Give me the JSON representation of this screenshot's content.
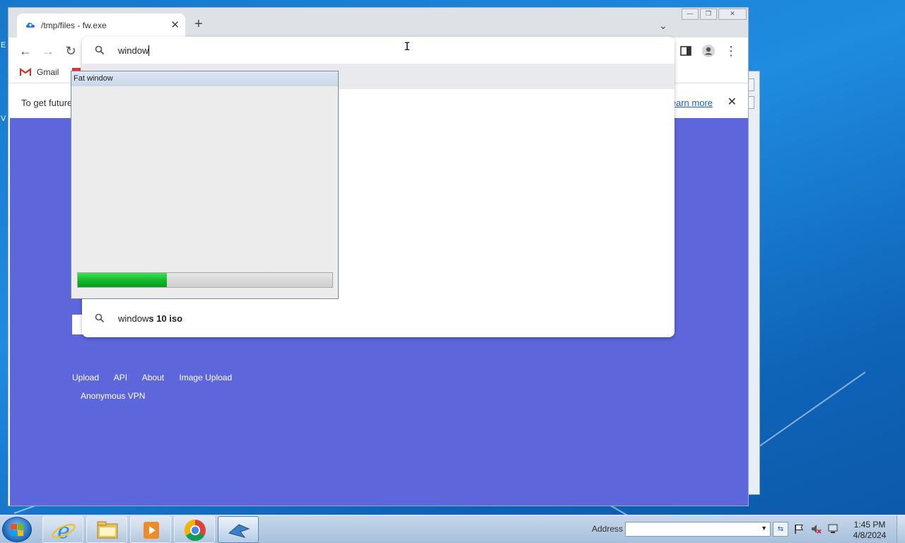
{
  "desktop": {
    "edge_left_1": "E",
    "edge_left_2": "V"
  },
  "browser": {
    "tab_title": "/tmp/files - fw.exe",
    "tab_close": "✕",
    "new_tab": "+",
    "tab_search": "⌄",
    "win_min": "—",
    "win_max": "❐",
    "win_close": "✕",
    "nav_back": "←",
    "nav_forward": "→",
    "nav_reload": "↻",
    "menu": "⋮",
    "bookmark_gmail": "Gmail",
    "infobar_text": "To get future",
    "infobar_link": "earn more",
    "infobar_close": "✕",
    "footer_links": [
      "Upload",
      "API",
      "About",
      "Image Upload"
    ],
    "footer_link_2": "Anonymous VPN"
  },
  "omnibox": {
    "query": "window",
    "suggestion_prefix": "window",
    "suggestion_bold": "s 10 iso"
  },
  "fat_window": {
    "caption": "Fat window",
    "progress": 0.35
  },
  "taskbar": {
    "address_label": "Address",
    "address_go": "⇆",
    "time": "1:45 PM",
    "date": "4/8/2024"
  },
  "colors": {
    "page_bg": "#5e66dc",
    "progress_green": "#12b52a",
    "link_blue": "#1a5fc0",
    "gmail_red": "#d93025"
  },
  "icons": [
    "drive-icon",
    "search-icon",
    "side-panel-icon",
    "profile-icon",
    "gmail-icon",
    "ie-icon",
    "explorer-icon",
    "media-player-icon",
    "chrome-icon",
    "app-icon",
    "flag-icon",
    "volume-muted-icon",
    "network-icon"
  ]
}
